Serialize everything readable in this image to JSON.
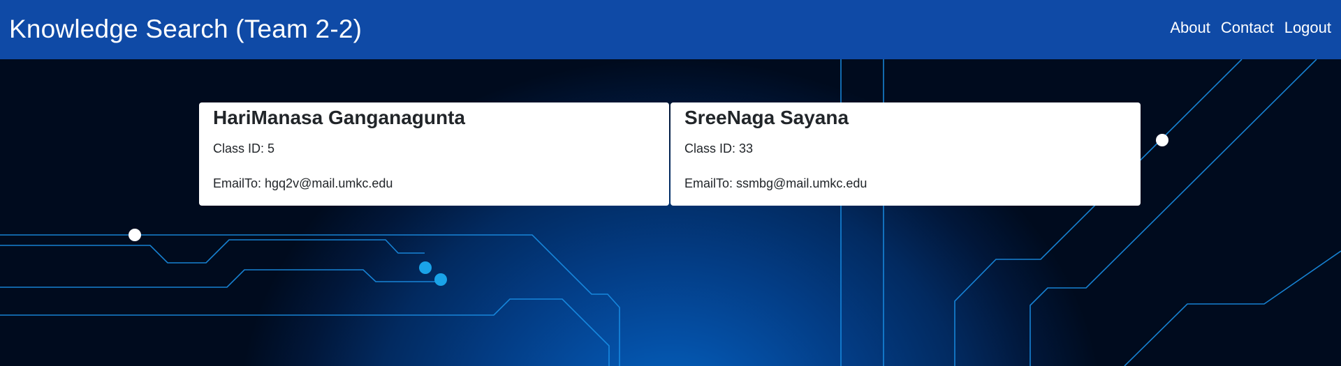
{
  "navbar": {
    "brand": "Knowledge Search (Team 2-2)",
    "links": [
      {
        "label": "About"
      },
      {
        "label": "Contact"
      },
      {
        "label": "Logout"
      }
    ]
  },
  "members": [
    {
      "name": "HariManasa Ganganagunta",
      "class_id": "Class ID: 5",
      "email": "EmailTo: hgq2v@mail.umkc.edu"
    },
    {
      "name": "SreeNaga Sayana",
      "class_id": "Class ID: 33",
      "email": "EmailTo: ssmbg@mail.umkc.edu"
    }
  ],
  "colors": {
    "navbar_bg": "#0f4aa6",
    "circuit_line": "#1a8fe6",
    "node_cyan": "#1aa3e8",
    "node_white": "#ffffff"
  }
}
